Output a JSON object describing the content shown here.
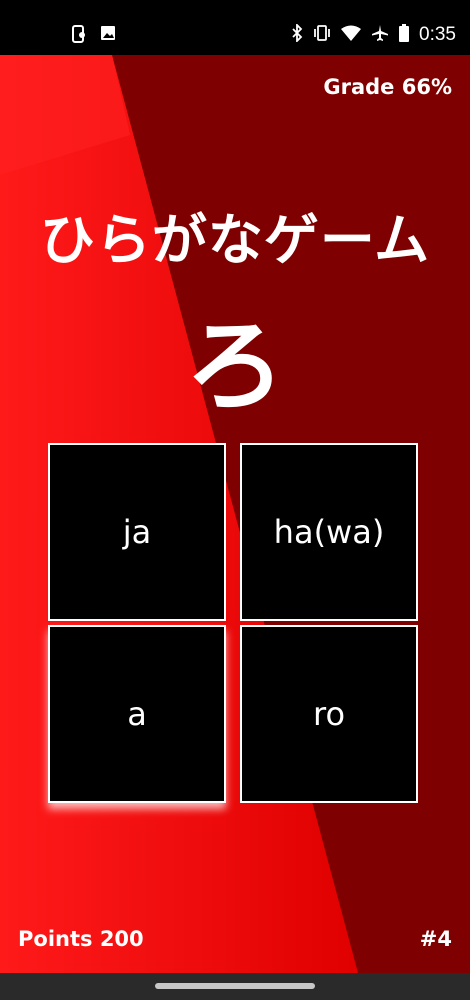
{
  "status_bar": {
    "time": "0:35",
    "left_icons": [
      "phone-sync-icon",
      "image-icon"
    ],
    "right_icons": [
      "bluetooth-icon",
      "vibrate-icon",
      "wifi-icon",
      "airplane-icon",
      "battery-icon"
    ]
  },
  "game": {
    "grade_label": "Grade 66%",
    "title": "ひらがなゲーム",
    "prompt_kana": "ろ",
    "answers": [
      {
        "label": "ja"
      },
      {
        "label": "ha(wa)"
      },
      {
        "label": "a"
      },
      {
        "label": "ro"
      }
    ],
    "points_label": "Points 200",
    "question_number": "#4"
  },
  "colors": {
    "bright_red": "#ff0000",
    "dark_red": "#7e0000",
    "tile_bg": "#000000",
    "tile_border": "#ffffff"
  }
}
